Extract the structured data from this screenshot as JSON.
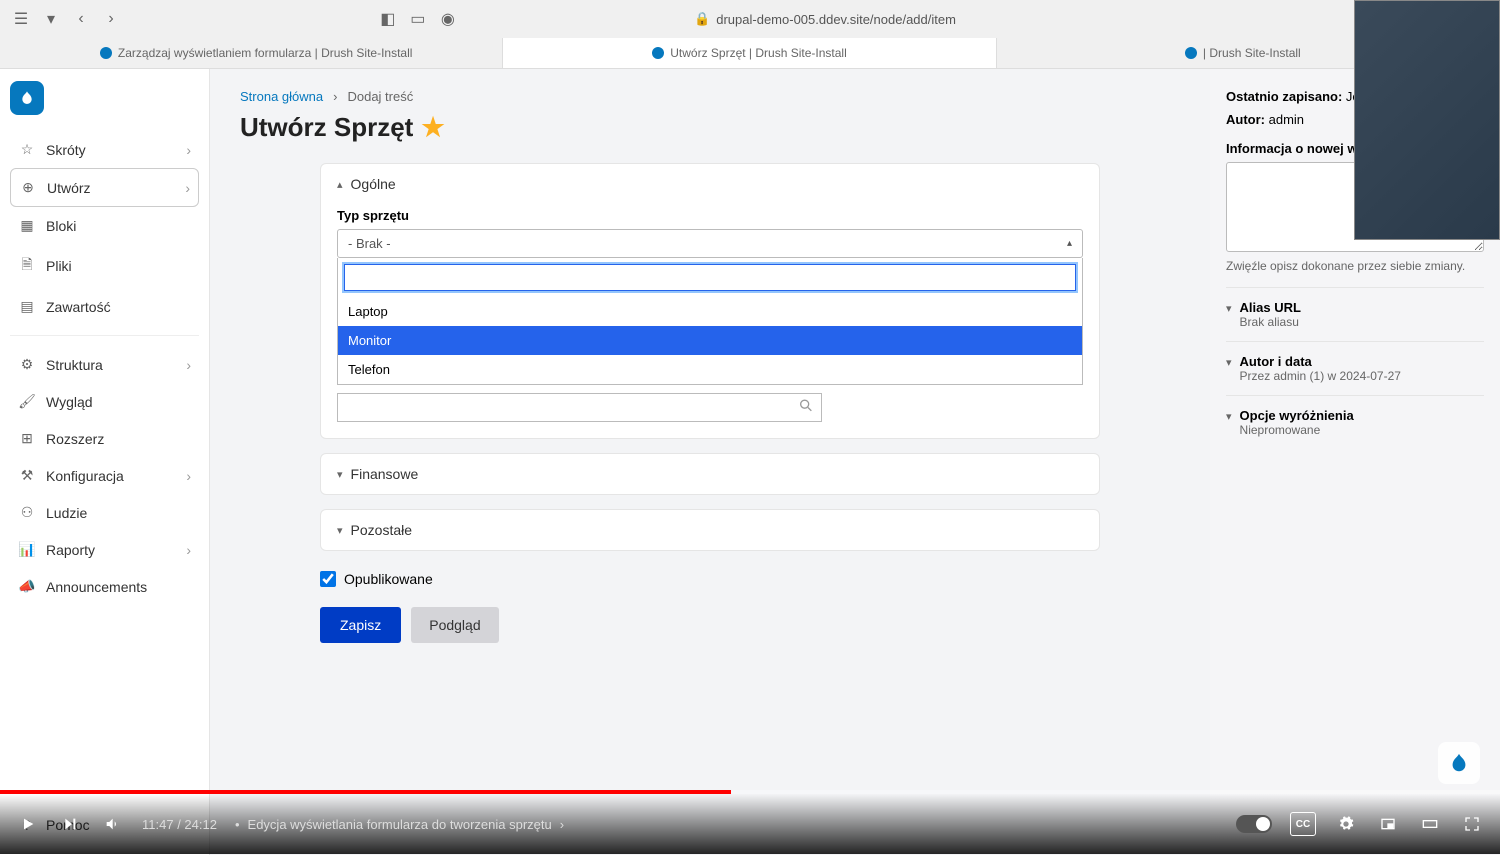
{
  "browser": {
    "url": "drupal-demo-005.ddev.site/node/add/item",
    "tabs": [
      "Zarządzaj wyświetlaniem formularza | Drush Site-Install",
      "Utwórz Sprzęt | Drush Site-Install",
      "| Drush Site-Install"
    ]
  },
  "sidebar": {
    "items": [
      {
        "icon": "star",
        "label": "Skróty",
        "chevron": true
      },
      {
        "icon": "plus",
        "label": "Utwórz",
        "chevron": true,
        "active": true
      },
      {
        "icon": "blocks",
        "label": "Bloki"
      },
      {
        "icon": "file",
        "label": "Pliki"
      },
      {
        "icon": "content",
        "label": "Zawartość"
      },
      {
        "sep": true
      },
      {
        "icon": "structure",
        "label": "Struktura",
        "chevron": true
      },
      {
        "icon": "brush",
        "label": "Wygląd"
      },
      {
        "icon": "puzzle",
        "label": "Rozszerz"
      },
      {
        "icon": "sliders",
        "label": "Konfiguracja",
        "chevron": true
      },
      {
        "icon": "people",
        "label": "Ludzie"
      },
      {
        "icon": "chart",
        "label": "Raporty",
        "chevron": true
      },
      {
        "icon": "megaphone",
        "label": "Announcements"
      }
    ],
    "footer": {
      "icon": "help",
      "label": "Pomoc"
    }
  },
  "breadcrumb": {
    "home": "Strona główna",
    "add": "Dodaj treść"
  },
  "page_title": "Utwórz Sprzęt",
  "sections": {
    "general": "Ogólne",
    "financial": "Finansowe",
    "other": "Pozostałe"
  },
  "type_field": {
    "label": "Typ sprzętu",
    "selected": "- Brak -",
    "search_value": "",
    "options": [
      "Laptop",
      "Monitor",
      "Telefon"
    ],
    "highlighted_index": 1
  },
  "published_label": "Opublikowane",
  "buttons": {
    "save": "Zapisz",
    "preview": "Podgląd"
  },
  "aside": {
    "last_saved_label": "Ostatnio zapisano:",
    "last_saved_value": "Jes",
    "author_label": "Autor:",
    "author_value": "admin",
    "revision_label": "Informacja o nowej wersji",
    "revision_help": "Zwięźle opisz dokonane przez siebie zmiany.",
    "accordions": [
      {
        "title": "Alias URL",
        "sub": "Brak aliasu"
      },
      {
        "title": "Autor i data",
        "sub": "Przez admin (1) w 2024-07-27"
      },
      {
        "title": "Opcje wyróżnienia",
        "sub": "Niepromowane"
      }
    ]
  },
  "player": {
    "current": "11:47",
    "total": "24:12",
    "separator": " / ",
    "bullet": " • ",
    "chapter": "Edycja wyświetlania formularza do tworzenia sprzętu"
  }
}
